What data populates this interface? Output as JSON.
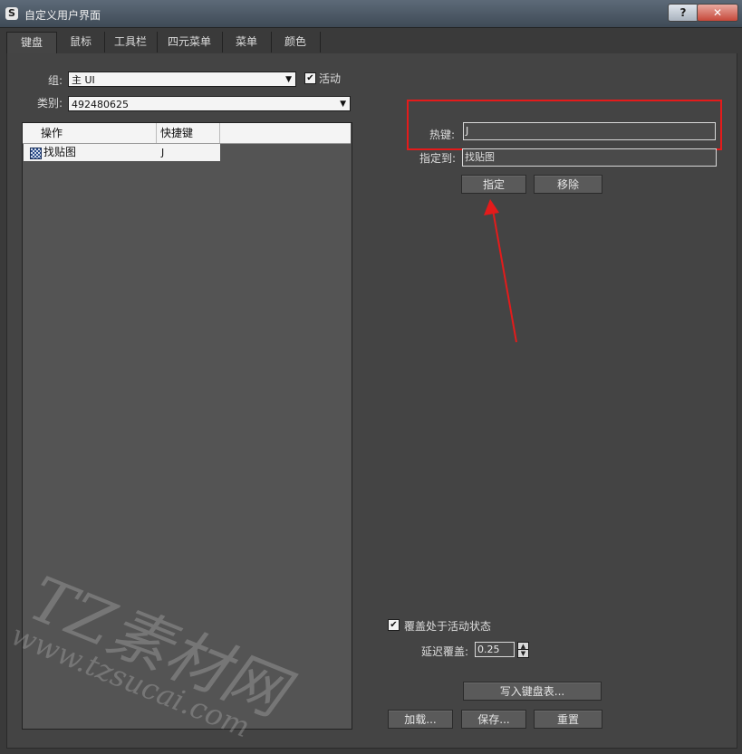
{
  "window": {
    "title": "自定义用户界面",
    "help_label": "?",
    "close_label": "✕",
    "app_icon": "3ds-max-icon"
  },
  "tabs": [
    {
      "label": "键盘",
      "active": true
    },
    {
      "label": "鼠标"
    },
    {
      "label": "工具栏"
    },
    {
      "label": "四元菜单"
    },
    {
      "label": "菜单"
    },
    {
      "label": "颜色"
    }
  ],
  "group": {
    "label": "组:",
    "value": "主 UI"
  },
  "active_checkbox": {
    "label": "活动",
    "checked": true
  },
  "category": {
    "label": "类别:",
    "value": "492480625"
  },
  "action_list": {
    "columns": [
      "操作",
      "快捷键"
    ],
    "rows": [
      {
        "action": "找贴图",
        "shortcut": "J"
      }
    ]
  },
  "hotkey": {
    "label": "热键:",
    "value": "J"
  },
  "assigned_to": {
    "label": "指定到:",
    "value": "找贴图"
  },
  "buttons": {
    "assign": "指定",
    "remove": "移除",
    "write_keyboard_chart": "写入键盘表...",
    "load": "加载...",
    "save": "保存...",
    "reset": "重置"
  },
  "override": {
    "label": "覆盖处于活动状态",
    "checked": true
  },
  "delay_override": {
    "label": "延迟覆盖:",
    "value": "0.25"
  },
  "annotation": {
    "highlight_color": "#e41b1b",
    "arrow_color": "#e41b1b"
  },
  "watermark": {
    "line1": "TZ素材网",
    "line2": "www.tzsucai.com"
  }
}
